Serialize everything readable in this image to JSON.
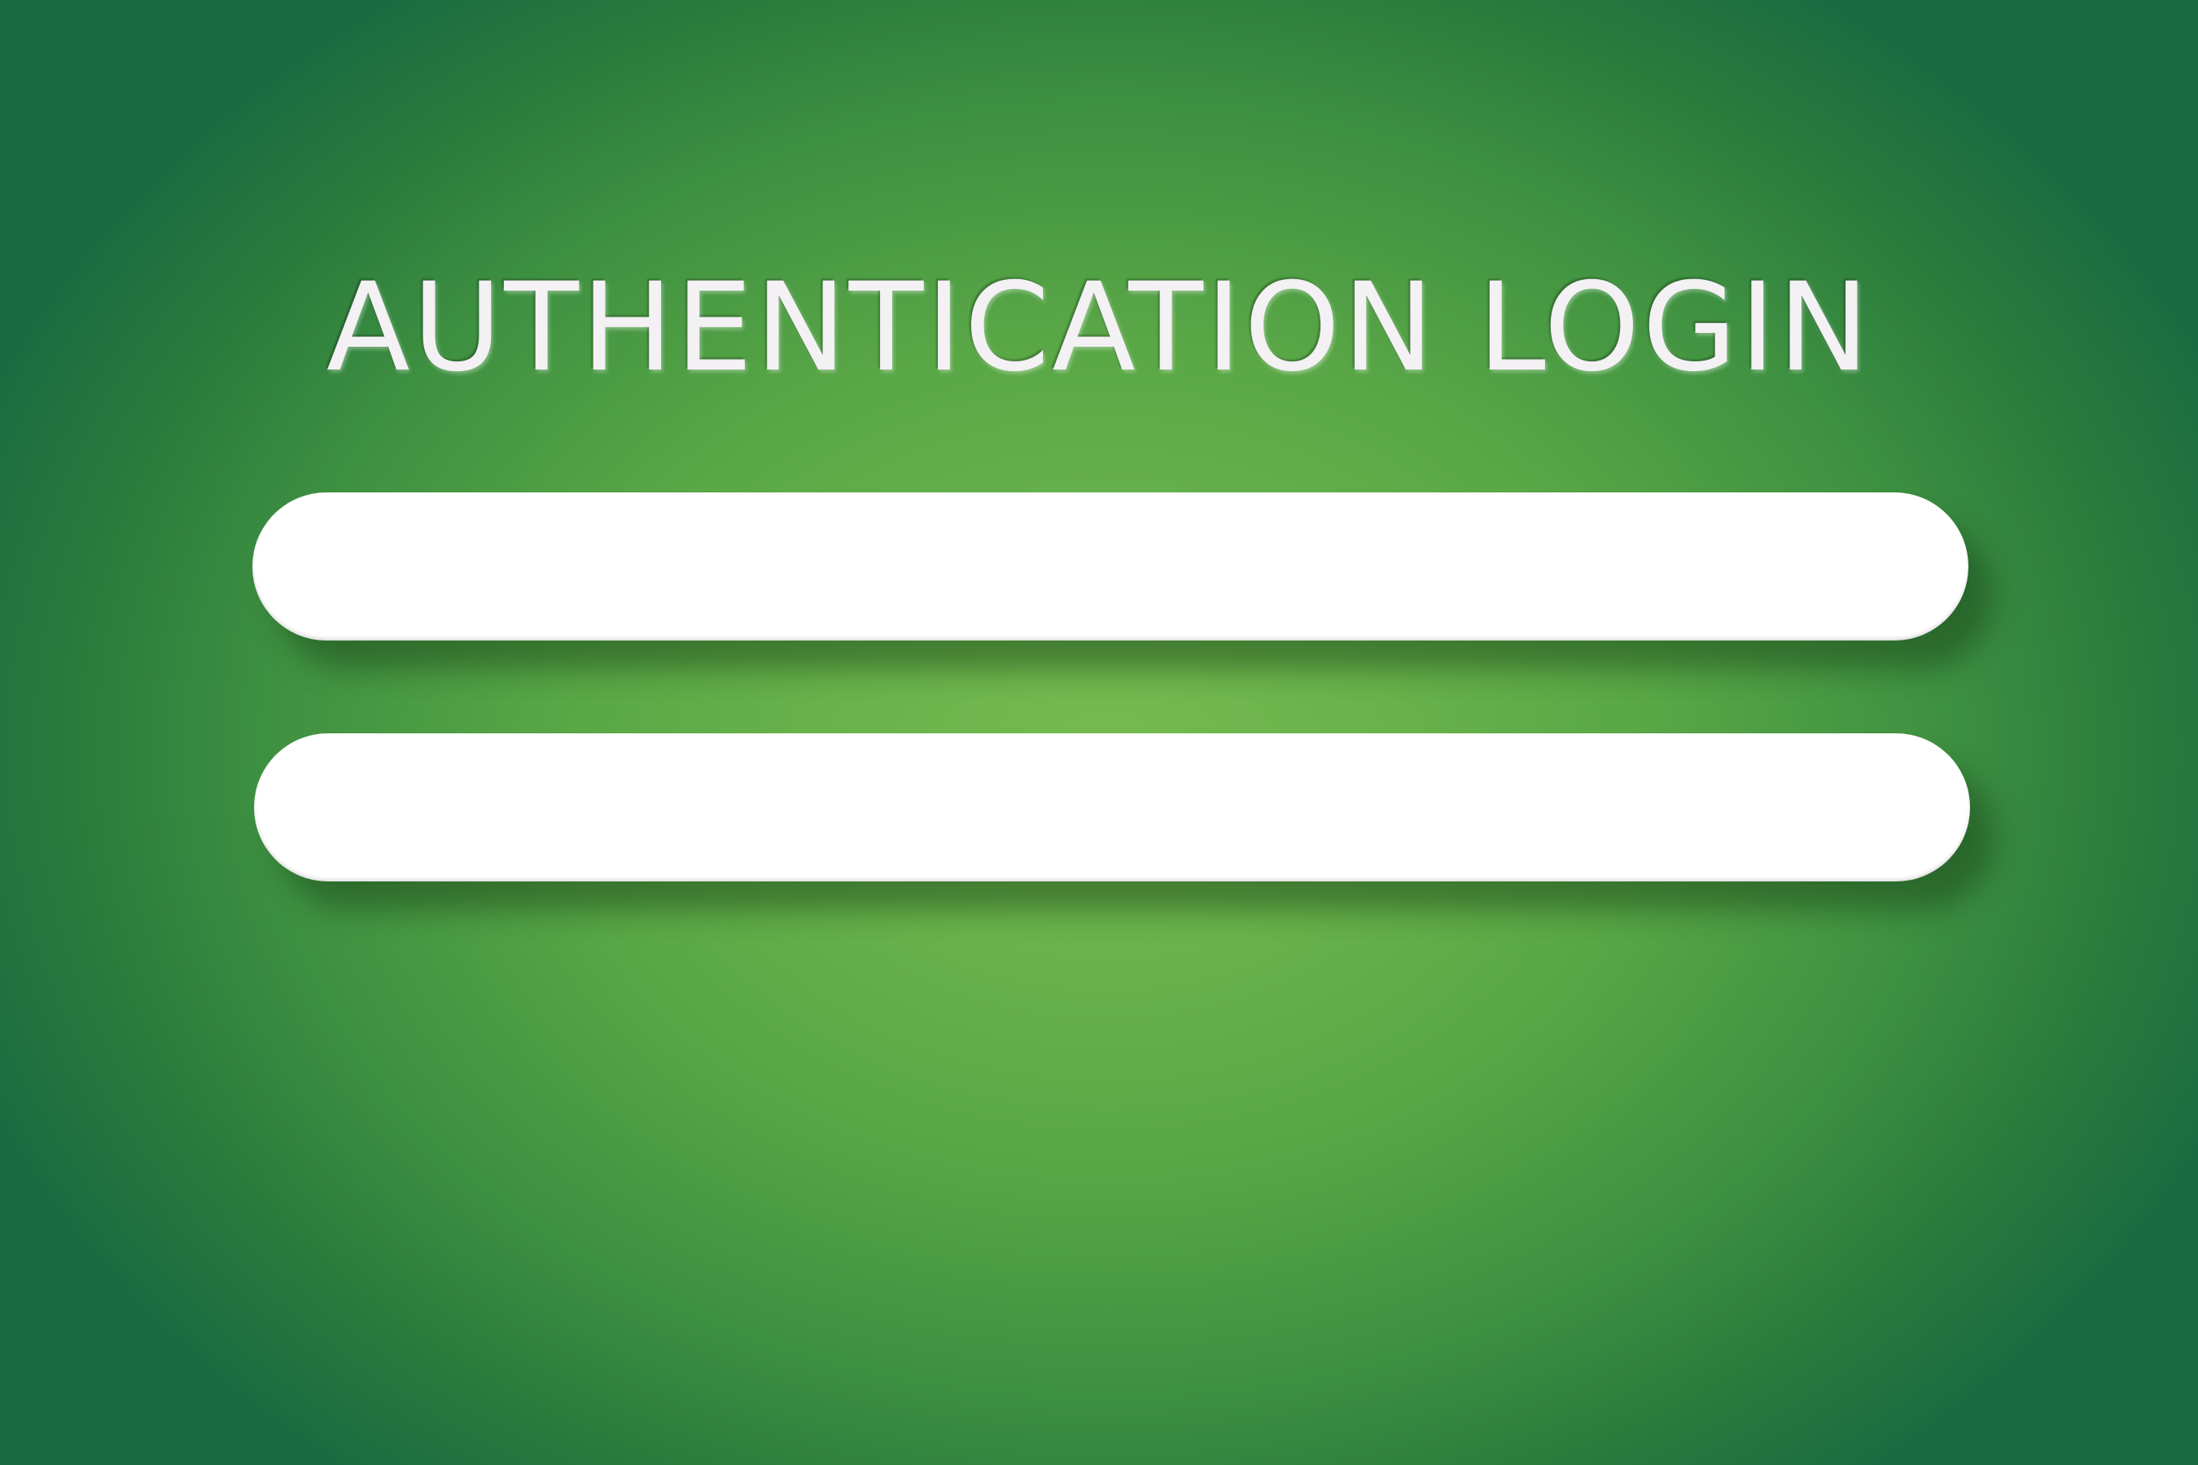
{
  "login": {
    "title": "AUTHENTICATION LOGIN",
    "fields": [
      {
        "value": "",
        "placeholder": ""
      },
      {
        "value": "",
        "placeholder": ""
      }
    ]
  },
  "colors": {
    "background_center": "#74ba4f",
    "background_edge": "#196b40",
    "title_text": "#f3f1f4",
    "field_fill": "#ffffff"
  }
}
